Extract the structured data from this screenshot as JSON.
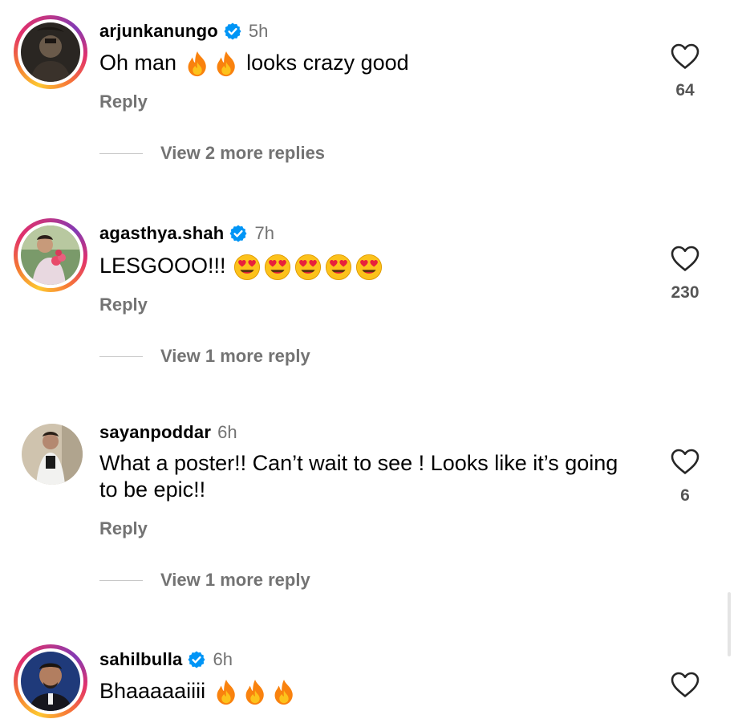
{
  "comments": [
    {
      "username": "arjunkanungo",
      "verified": true,
      "time": "5h",
      "text_parts": [
        "Oh man ",
        "fire",
        "fire",
        " looks crazy good"
      ],
      "text_a": "Oh man",
      "text_b": "looks crazy good",
      "reply_label": "Reply",
      "likes": "64",
      "view_more": "View 2 more replies",
      "ring": true
    },
    {
      "username": "agasthya.shah",
      "verified": true,
      "time": "7h",
      "text_a": "LESGOOO!!!",
      "emojis": [
        "heart-eyes-emoji",
        "heart-eyes-emoji",
        "heart-eyes-emoji",
        "heart-eyes-emoji",
        "heart-eyes-emoji"
      ],
      "reply_label": "Reply",
      "likes": "230",
      "view_more": "View 1 more reply",
      "ring": true
    },
    {
      "username": "sayanpoddar",
      "verified": false,
      "time": "6h",
      "text_a": "What a poster!! Can’t wait to see ! Looks like it’s going to be epic!!",
      "reply_label": "Reply",
      "likes": "6",
      "view_more": "View 1 more reply",
      "ring": false
    },
    {
      "username": "sahilbulla",
      "verified": true,
      "time": "6h",
      "text_a": "Bhaaaaaiiii",
      "emojis": [
        "fire-emoji",
        "fire-emoji",
        "fire-emoji"
      ],
      "ring": true
    }
  ],
  "icons": {
    "verified": "verified-badge-icon",
    "like": "heart-outline-icon",
    "fire": "fire-emoji",
    "heart_eyes": "heart-eyes-emoji"
  },
  "colors": {
    "verified_blue": "#0095f6",
    "secondary_text": "#737373",
    "fire_orange": "#f9820e",
    "emoji_yellow": "#fcc21b"
  }
}
